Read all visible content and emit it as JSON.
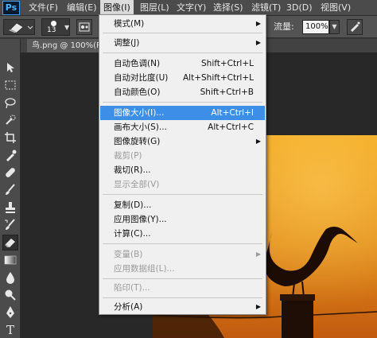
{
  "app": {
    "logo": "Ps"
  },
  "menubar": {
    "items": [
      {
        "label": "文件(F)"
      },
      {
        "label": "编辑(E)"
      },
      {
        "label": "图像(I)"
      },
      {
        "label": "图层(L)"
      },
      {
        "label": "文字(Y)"
      },
      {
        "label": "选择(S)"
      },
      {
        "label": "滤镜(T)"
      },
      {
        "label": "3D(D)"
      },
      {
        "label": "视图(V)"
      }
    ]
  },
  "options": {
    "brush_size": "13",
    "flow_label": "流量:",
    "flow_value": "100%"
  },
  "document": {
    "tab_title": "鸟.png @ 100%(R"
  },
  "image_menu": {
    "items": [
      {
        "label": "模式(M)",
        "shortcut": "",
        "submenu": true,
        "enabled": true
      },
      {
        "label": "调整(J)",
        "shortcut": "",
        "submenu": true,
        "enabled": true
      },
      {
        "label": "自动色调(N)",
        "shortcut": "Shift+Ctrl+L",
        "submenu": false,
        "enabled": true
      },
      {
        "label": "自动对比度(U)",
        "shortcut": "Alt+Shift+Ctrl+L",
        "submenu": false,
        "enabled": true
      },
      {
        "label": "自动颜色(O)",
        "shortcut": "Shift+Ctrl+B",
        "submenu": false,
        "enabled": true
      },
      {
        "label": "图像大小(I)...",
        "shortcut": "Alt+Ctrl+I",
        "submenu": false,
        "enabled": true,
        "highlighted": true
      },
      {
        "label": "画布大小(S)...",
        "shortcut": "Alt+Ctrl+C",
        "submenu": false,
        "enabled": true
      },
      {
        "label": "图像旋转(G)",
        "shortcut": "",
        "submenu": true,
        "enabled": true
      },
      {
        "label": "裁剪(P)",
        "shortcut": "",
        "submenu": false,
        "enabled": false
      },
      {
        "label": "裁切(R)...",
        "shortcut": "",
        "submenu": false,
        "enabled": true
      },
      {
        "label": "显示全部(V)",
        "shortcut": "",
        "submenu": false,
        "enabled": false
      },
      {
        "label": "复制(D)...",
        "shortcut": "",
        "submenu": false,
        "enabled": true
      },
      {
        "label": "应用图像(Y)...",
        "shortcut": "",
        "submenu": false,
        "enabled": true
      },
      {
        "label": "计算(C)...",
        "shortcut": "",
        "submenu": false,
        "enabled": true
      },
      {
        "label": "变量(B)",
        "shortcut": "",
        "submenu": true,
        "enabled": false
      },
      {
        "label": "应用数据组(L)...",
        "shortcut": "",
        "submenu": false,
        "enabled": false
      },
      {
        "label": "陷印(T)...",
        "shortcut": "",
        "submenu": false,
        "enabled": false
      },
      {
        "label": "分析(A)",
        "shortcut": "",
        "submenu": true,
        "enabled": true
      }
    ]
  },
  "colors": {
    "menu_highlight": "#3d8ee6",
    "disabled_text": "#9a9a9a",
    "sunset_top": "#f2a81e",
    "sunset_bottom": "#c25a10"
  }
}
